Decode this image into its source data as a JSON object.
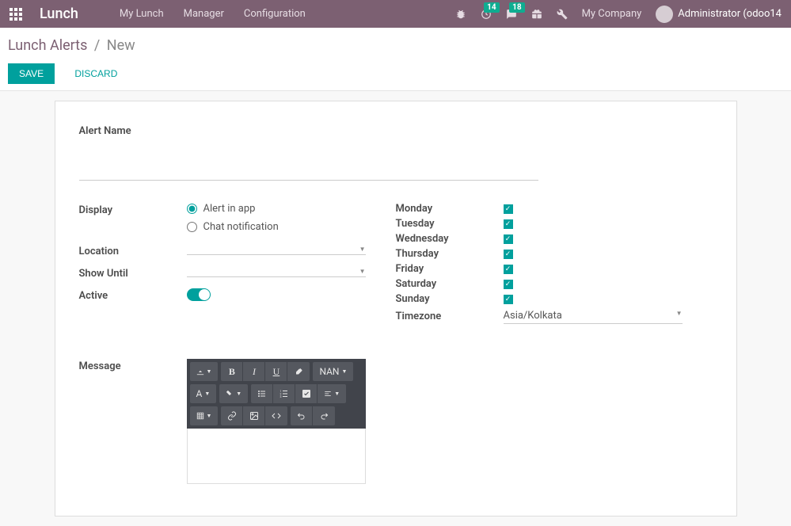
{
  "navbar": {
    "brand": "Lunch",
    "links": [
      "My Lunch",
      "Manager",
      "Configuration"
    ],
    "badges": {
      "clock": "14",
      "chat": "18"
    },
    "company": "My Company",
    "user": "Administrator (odoo14"
  },
  "breadcrumb": {
    "parent": "Lunch Alerts",
    "current": "New"
  },
  "actions": {
    "save": "SAVE",
    "discard": "DISCARD"
  },
  "form": {
    "alert_name_label": "Alert Name",
    "display_label": "Display",
    "display_options": {
      "app": "Alert in app",
      "chat": "Chat notification"
    },
    "location_label": "Location",
    "show_until_label": "Show Until",
    "active_label": "Active",
    "days": {
      "mon": "Monday",
      "tue": "Tuesday",
      "wed": "Wednesday",
      "thu": "Thursday",
      "fri": "Friday",
      "sat": "Saturday",
      "sun": "Sunday"
    },
    "timezone_label": "Timezone",
    "timezone_value": "Asia/Kolkata",
    "message_label": "Message"
  },
  "editor": {
    "size_label": "NAN"
  }
}
